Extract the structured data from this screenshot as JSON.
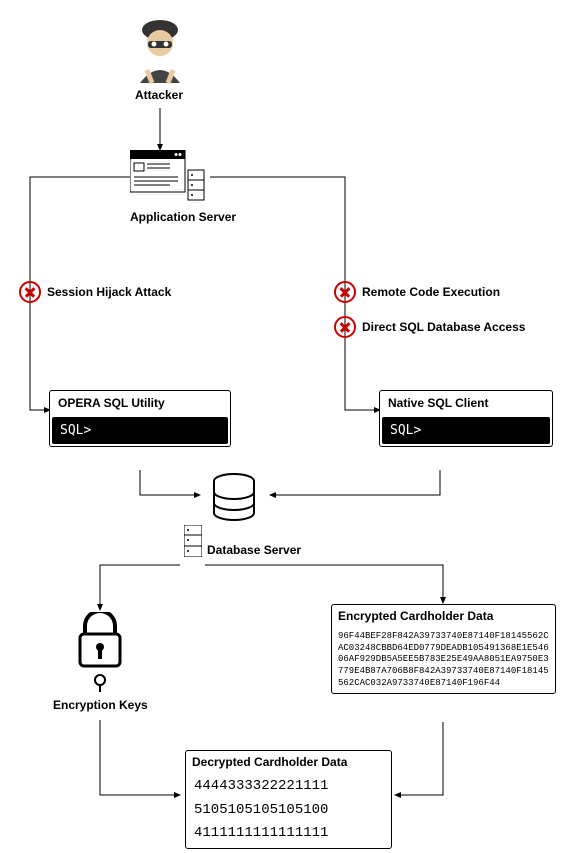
{
  "nodes": {
    "attacker": "Attacker",
    "app_server": "Application Server",
    "db_server": "Database Server",
    "opera": {
      "title": "OPERA SQL Utility",
      "prompt": "SQL>"
    },
    "native": {
      "title": "Native SQL Client",
      "prompt": "SQL>"
    },
    "enc_box_title": "Encrypted Cardholder Data",
    "enc_box_data": "96F44BEF28F842A39733740E87140F18145562CAC03248CBBD64ED0779DEADB105491368E1E54606AF929DB5A5EE5B783E25E49AA8051EA9750E3779E4B87A706B8F842A39733740E87140F18145562CAC032A9733740E87140F196F44",
    "enc_keys": "Encryption Keys",
    "dec_box_title": "Decrypted Cardholder Data",
    "dec_lines": [
      "4444333322221111",
      "5105105105105100",
      "4111111111111111"
    ]
  },
  "attacks": {
    "session": "Session Hijack Attack",
    "rce": "Remote Code Execution",
    "sql": "Direct SQL Database Access"
  }
}
